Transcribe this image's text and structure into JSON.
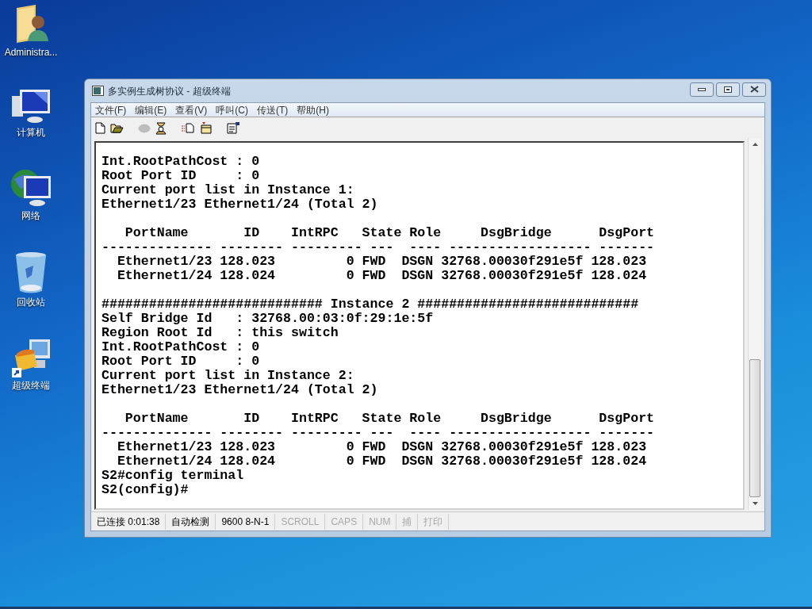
{
  "desktop_icons": [
    {
      "kind": "user-folder",
      "label": "Administra..."
    },
    {
      "kind": "computer",
      "label": "计算机"
    },
    {
      "kind": "network",
      "label": "网络"
    },
    {
      "kind": "recycle-bin",
      "label": "回收站"
    },
    {
      "kind": "terminal",
      "label": "超级终端"
    }
  ],
  "window": {
    "title": "多实例生成树协议 - 超级终端",
    "menu": [
      "文件(F)",
      "编辑(E)",
      "查看(V)",
      "呼叫(C)",
      "传送(T)",
      "帮助(H)"
    ],
    "toolbar": [
      {
        "kind": "new",
        "disabled": false
      },
      {
        "kind": "open",
        "disabled": false
      },
      {
        "kind": "disconnect",
        "disabled": true
      },
      {
        "kind": "dial",
        "disabled": false
      },
      {
        "kind": "send",
        "disabled": false
      },
      {
        "kind": "receive",
        "disabled": false
      },
      {
        "kind": "properties",
        "disabled": false
      }
    ],
    "terminal_blocks": [
      [
        "Int.RootPathCost : 0",
        "Root Port ID     : 0",
        "Current port list in Instance 1:",
        "Ethernet1/23 Ethernet1/24 (Total 2)"
      ],
      [
        "   PortName       ID    IntRPC   State Role     DsgBridge      DsgPort",
        "-------------- -------- --------- ---  ---- ------------------ -------",
        "  Ethernet1/23 128.023         0 FWD  DSGN 32768.00030f291e5f 128.023",
        "  Ethernet1/24 128.024         0 FWD  DSGN 32768.00030f291e5f 128.024"
      ],
      [
        "############################ Instance 2 ############################",
        "Self Bridge Id   : 32768.00:03:0f:29:1e:5f",
        "Region Root Id   : this switch",
        "Int.RootPathCost : 0",
        "Root Port ID     : 0",
        "Current port list in Instance 2:",
        "Ethernet1/23 Ethernet1/24 (Total 2)"
      ],
      [
        "   PortName       ID    IntRPC   State Role     DsgBridge      DsgPort",
        "-------------- -------- --------- ---  ---- ------------------ -------",
        "  Ethernet1/23 128.023         0 FWD  DSGN 32768.00030f291e5f 128.023",
        "  Ethernet1/24 128.024         0 FWD  DSGN 32768.00030f291e5f 128.024",
        "S2#config terminal",
        "S2(config)#"
      ]
    ],
    "status_bar": [
      {
        "text": "已连接 0:01:38",
        "on": true
      },
      {
        "text": "自动检测",
        "on": true
      },
      {
        "text": "9600 8-N-1",
        "on": true
      },
      {
        "text": "SCROLL",
        "on": false
      },
      {
        "text": "CAPS",
        "on": false
      },
      {
        "text": "NUM",
        "on": false
      },
      {
        "text": "捕",
        "on": false
      },
      {
        "text": "打印",
        "on": false
      }
    ]
  }
}
